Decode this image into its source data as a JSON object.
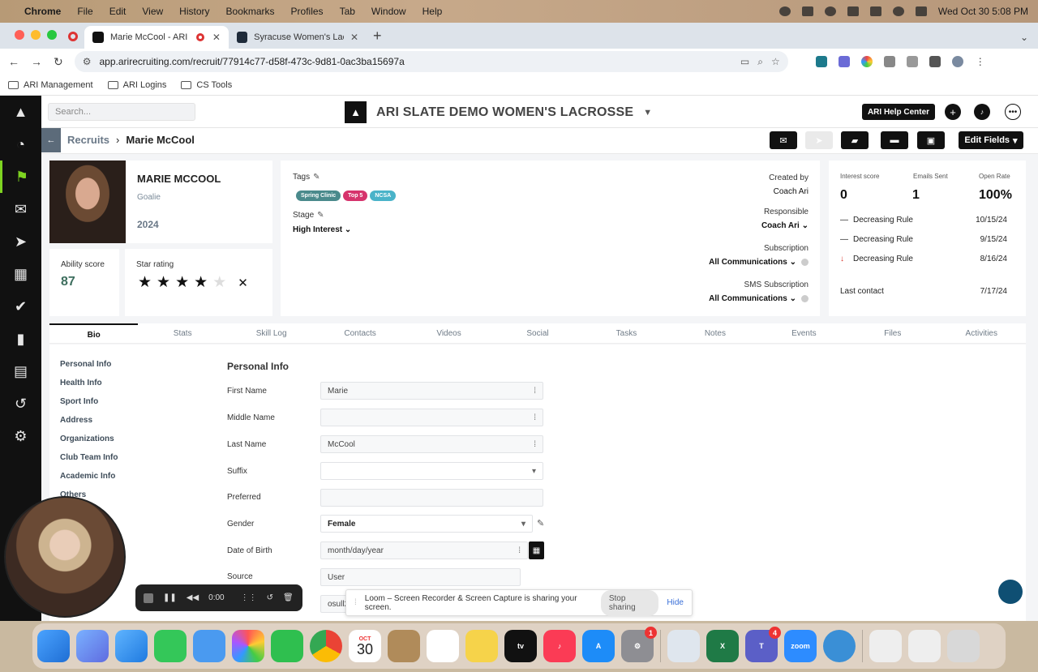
{
  "menubar": {
    "items": [
      "Chrome",
      "File",
      "Edit",
      "View",
      "History",
      "Bookmarks",
      "Profiles",
      "Tab",
      "Window",
      "Help"
    ],
    "clock": "Wed Oct 30  5:08 PM"
  },
  "browser": {
    "tabs": [
      {
        "title": "Marie McCool - ARI",
        "active": true
      },
      {
        "title": "Syracuse Women's Lacrosse",
        "active": false
      }
    ],
    "url": "app.arirecruiting.com/recruit/77914c77-d58f-473c-9d81-0ac3ba15697a",
    "bookmarks": [
      "ARI Management",
      "ARI Logins",
      "CS Tools"
    ]
  },
  "header": {
    "search_placeholder": "Search...",
    "team_name": "ARI SLATE DEMO WOMEN'S LACROSSE",
    "help_label": "ARI Help Center"
  },
  "breadcrumb": {
    "parent": "Recruits",
    "current": "Marie McCool"
  },
  "toolbar": {
    "edit_fields_label": "Edit Fields"
  },
  "profile": {
    "name": "MARIE MCCOOL",
    "position": "Goalie",
    "year": "2024",
    "ability_label": "Ability score",
    "ability_score": "87",
    "star_label": "Star rating",
    "star_rating": 4,
    "star_max": 5
  },
  "details": {
    "tags_label": "Tags",
    "tags": [
      {
        "label": "Spring Clinic",
        "color": "#4a8a8c"
      },
      {
        "label": "Top 5",
        "color": "#d6336c"
      },
      {
        "label": "NCSA",
        "color": "#4ab3c9"
      }
    ],
    "stage_label": "Stage",
    "stage_value": "High Interest",
    "created_by_label": "Created by",
    "created_by_value": "Coach Ari",
    "responsible_label": "Responsible",
    "responsible_value": "Coach Ari",
    "subscription_label": "Subscription",
    "subscription_value": "All Communications",
    "sms_label": "SMS Subscription",
    "sms_value": "All Communications"
  },
  "stats": {
    "interest_label": "Interest score",
    "interest_value": "0",
    "emails_label": "Emails Sent",
    "emails_value": "1",
    "open_label": "Open Rate",
    "open_value": "100%",
    "rules": [
      {
        "label": "Decreasing Rule",
        "date": "10/15/24",
        "marker": "—"
      },
      {
        "label": "Decreasing Rule",
        "date": "9/15/24",
        "marker": "—"
      },
      {
        "label": "Decreasing Rule",
        "date": "8/16/24",
        "marker": "↓"
      }
    ],
    "last_contact_label": "Last contact",
    "last_contact_value": "7/17/24"
  },
  "tabs": [
    "Bio",
    "Stats",
    "Skill Log",
    "Contacts",
    "Videos",
    "Social",
    "Tasks",
    "Notes",
    "Events",
    "Files",
    "Activities"
  ],
  "sidemenu": [
    "Personal Info",
    "Health Info",
    "Sport Info",
    "Address",
    "Organizations",
    "Club Team Info",
    "Academic Info",
    "Others"
  ],
  "form": {
    "title": "Personal Info",
    "first_name_label": "First Name",
    "first_name_value": "Marie",
    "middle_name_label": "Middle Name",
    "middle_name_value": "",
    "last_name_label": "Last Name",
    "last_name_value": "McCool",
    "suffix_label": "Suffix",
    "suffix_value": "",
    "preferred_label": "Preferred",
    "preferred_value": "",
    "gender_label": "Gender",
    "gender_value": "Female",
    "dob_label": "Date of Birth",
    "dob_placeholder": "month/day/year",
    "source_label": "Source",
    "source_value": "User",
    "extra_value": "osull2"
  },
  "recorder": {
    "time": "0:00"
  },
  "share": {
    "message": "Loom – Screen Recorder & Screen Capture is sharing your screen.",
    "stop_label": "Stop sharing",
    "hide_label": "Hide"
  },
  "dock": {
    "calendar_month": "OCT",
    "calendar_day": "30",
    "appletv_label": "tv",
    "zoom_label": "zoom",
    "badge_settings": "1",
    "badge_teams": "4"
  }
}
